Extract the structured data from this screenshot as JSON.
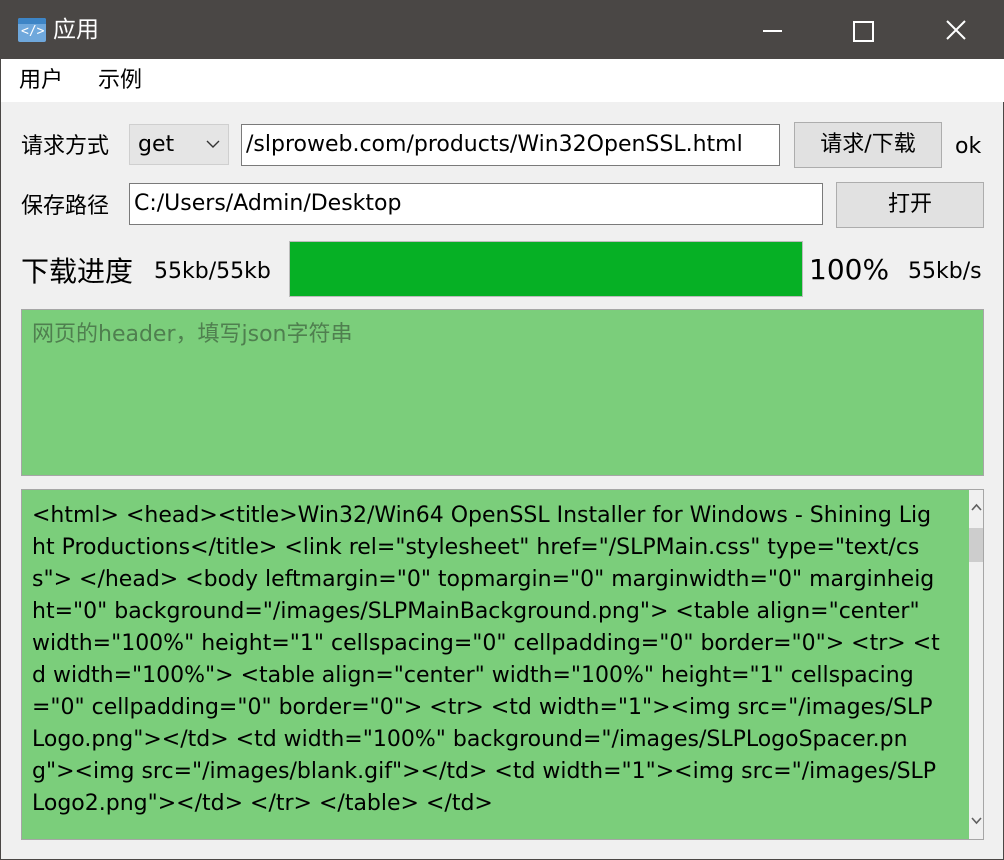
{
  "window": {
    "title": "应用",
    "icon": "code-window-icon",
    "controls": {
      "minimize": "minimize-icon",
      "maximize": "maximize-icon",
      "close": "close-icon"
    }
  },
  "menu": {
    "items": [
      {
        "label": "用户"
      },
      {
        "label": "示例"
      }
    ]
  },
  "request": {
    "method_label": "请求方式",
    "method_value": "get",
    "url_value": "/slproweb.com/products/Win32OpenSSL.html",
    "button_label": "请求/下载",
    "status": "ok"
  },
  "save": {
    "path_label": "保存路径",
    "path_value": "C:/Users/Admin/Desktop",
    "open_label": "打开"
  },
  "progress": {
    "label": "下载进度",
    "size_text": "55kb/55kb",
    "fraction": 1.0,
    "percent_text": "100%",
    "speed_text": "55kb/s",
    "fill_color": "#06b025"
  },
  "header_input": {
    "placeholder": "网页的header，填写json字符串",
    "background_color": "#7bce7b"
  },
  "content": {
    "text": "<html> <head><title>Win32/Win64 OpenSSL Installer for Windows - Shining Light Productions</title> <link rel=\"stylesheet\" href=\"/SLPMain.css\" type=\"text/css\"> </head> <body leftmargin=\"0\" topmargin=\"0\" marginwidth=\"0\" marginheight=\"0\" background=\"/images/SLPMainBackground.png\"> <table align=\"center\" width=\"100%\" height=\"1\" cellspacing=\"0\" cellpadding=\"0\" border=\"0\"> <tr> <td width=\"100%\"> <table align=\"center\" width=\"100%\" height=\"1\" cellspacing=\"0\" cellpadding=\"0\" border=\"0\"> <tr> <td width=\"1\"><img src=\"/images/SLPLogo.png\"></td> <td width=\"100%\" background=\"/images/SLPLogoSpacer.png\"><img src=\"/images/blank.gif\"></td> <td width=\"1\"><img src=\"/images/SLPLogo2.png\"></td> </tr> </table> </td>"
  }
}
